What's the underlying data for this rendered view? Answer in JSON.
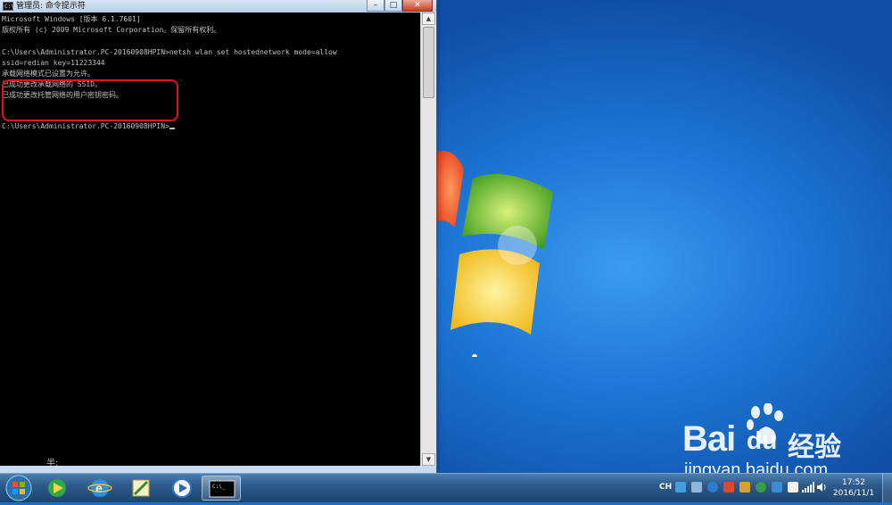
{
  "window": {
    "title": "管理员: 命令提示符",
    "icon_label": "C:\\",
    "minimize": "–",
    "maximize": "□",
    "close": "✕"
  },
  "console": {
    "lines": [
      "Microsoft Windows [版本 6.1.7601]",
      "版权所有 (c) 2009 Microsoft Corporation。保留所有权利。",
      "",
      "C:\\Users\\Administrator.PC-20160908HPIN>netsh wlan set hostednetwork mode=allow",
      "ssid=redian key=11223344",
      "承载网络模式已设置为允许。",
      "已成功更改承载网络的 SSID。",
      "已成功更改托管网络的用户密钥密码。",
      "",
      "",
      "C:\\Users\\Administrator.PC-20160908HPIN>"
    ],
    "ime_status": "半:"
  },
  "watermark": {
    "brand": "Bai",
    "brand_suffix": "du",
    "brand_cn": "经验",
    "url": "jingyan.baidu.com"
  },
  "taskbar": {
    "items": [
      "start-orb",
      "media-player-icon",
      "ie-icon",
      "paint-icon",
      "windows-media-icon",
      "cmd-icon"
    ],
    "tray": {
      "lang": "CH"
    },
    "clock": {
      "time": "17:52",
      "date": "2016/11/1"
    }
  }
}
